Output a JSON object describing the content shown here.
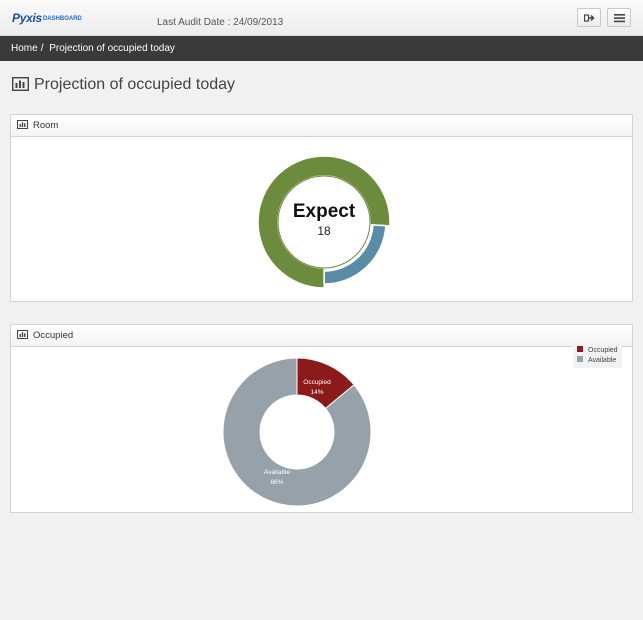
{
  "header": {
    "logo_text": "Pyxis",
    "logo_subtext": "DASHBOARD",
    "audit_label": "Last Audit Date : 24/09/2013",
    "logout_icon": "sign-out-icon",
    "menu_icon": "menu-icon"
  },
  "breadcrumb": {
    "home": "Home",
    "separator": "/",
    "current": "Projection of occupied today"
  },
  "page": {
    "title": "Projection of occupied today",
    "title_icon": "bar-chart-icon"
  },
  "room_panel": {
    "label": "Room",
    "center_title": "Expect",
    "center_value": "18"
  },
  "occupied_panel": {
    "label": "Occupied",
    "legend": [
      {
        "label": "Occupied",
        "color": "#8b1a1a"
      },
      {
        "label": "Available",
        "color": "#96a1aa"
      }
    ]
  },
  "chart_data": [
    {
      "type": "pie",
      "variant": "ring",
      "center_text": "Expect",
      "center_value": 18,
      "segments": [
        {
          "value": 76,
          "color": "#6d8b3d"
        },
        {
          "value": 24,
          "color": "#5a8da5"
        }
      ]
    },
    {
      "type": "pie",
      "variant": "donut",
      "categories": [
        "Occupied",
        "Available"
      ],
      "values": [
        14,
        86
      ],
      "data_labels": [
        "14%",
        "86%"
      ],
      "colors": [
        "#8b1a1a",
        "#96a1aa"
      ],
      "legend": "top-right"
    }
  ]
}
